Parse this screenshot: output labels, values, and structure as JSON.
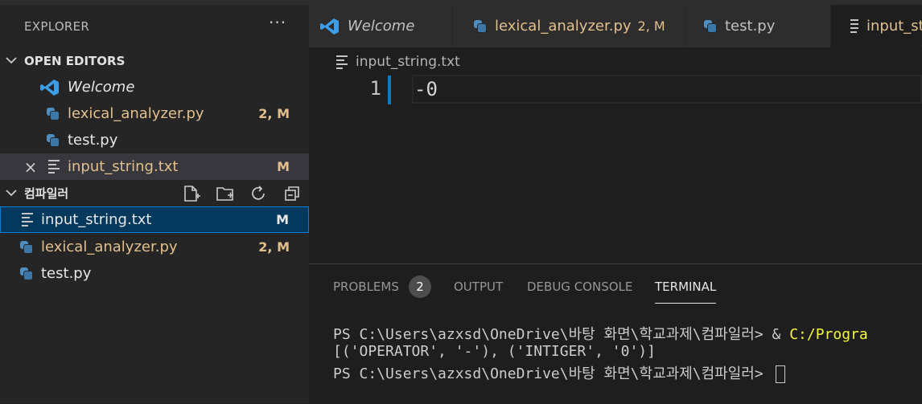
{
  "sidebar": {
    "header": "EXPLORER",
    "more": "···",
    "open_editors": {
      "title": "OPEN EDITORS",
      "items": [
        {
          "label": "Welcome",
          "badge": ""
        },
        {
          "label": "lexical_analyzer.py",
          "badge": "2, M"
        },
        {
          "label": "test.py",
          "badge": ""
        },
        {
          "label": "input_string.txt",
          "badge": "M"
        }
      ]
    },
    "folder": {
      "title": "컴파일러",
      "items": [
        {
          "label": "input_string.txt",
          "badge": "M"
        },
        {
          "label": "lexical_analyzer.py",
          "badge": "2, M"
        },
        {
          "label": "test.py",
          "badge": ""
        }
      ]
    }
  },
  "tabs": [
    {
      "label": "Welcome",
      "badge": ""
    },
    {
      "label": "lexical_analyzer.py",
      "badge": "2, M"
    },
    {
      "label": "test.py",
      "badge": ""
    },
    {
      "label": "input_st",
      "badge": ""
    }
  ],
  "editor": {
    "breadcrumb": "input_string.txt",
    "line_number": "1",
    "code": "-0"
  },
  "panel": {
    "tabs": {
      "problems": "PROBLEMS",
      "problems_count": "2",
      "output": "OUTPUT",
      "debug": "DEBUG CONSOLE",
      "terminal": "TERMINAL"
    },
    "terminal": {
      "line1_prompt": "PS C:\\Users\\azxsd\\OneDrive\\바탕 화면\\학교과제\\컴파일러> & ",
      "line1_cmd": "C:/Progra",
      "line2": "[('OPERATOR', '-'), ('INTIGER', '0')]",
      "line3_prompt": "PS C:\\Users\\azxsd\\OneDrive\\바탕 화면\\학교과제\\컴파일러> "
    }
  },
  "colors": {
    "accent": "#007fd4",
    "modified": "#e2c08d",
    "selected_bg": "#04395e"
  }
}
